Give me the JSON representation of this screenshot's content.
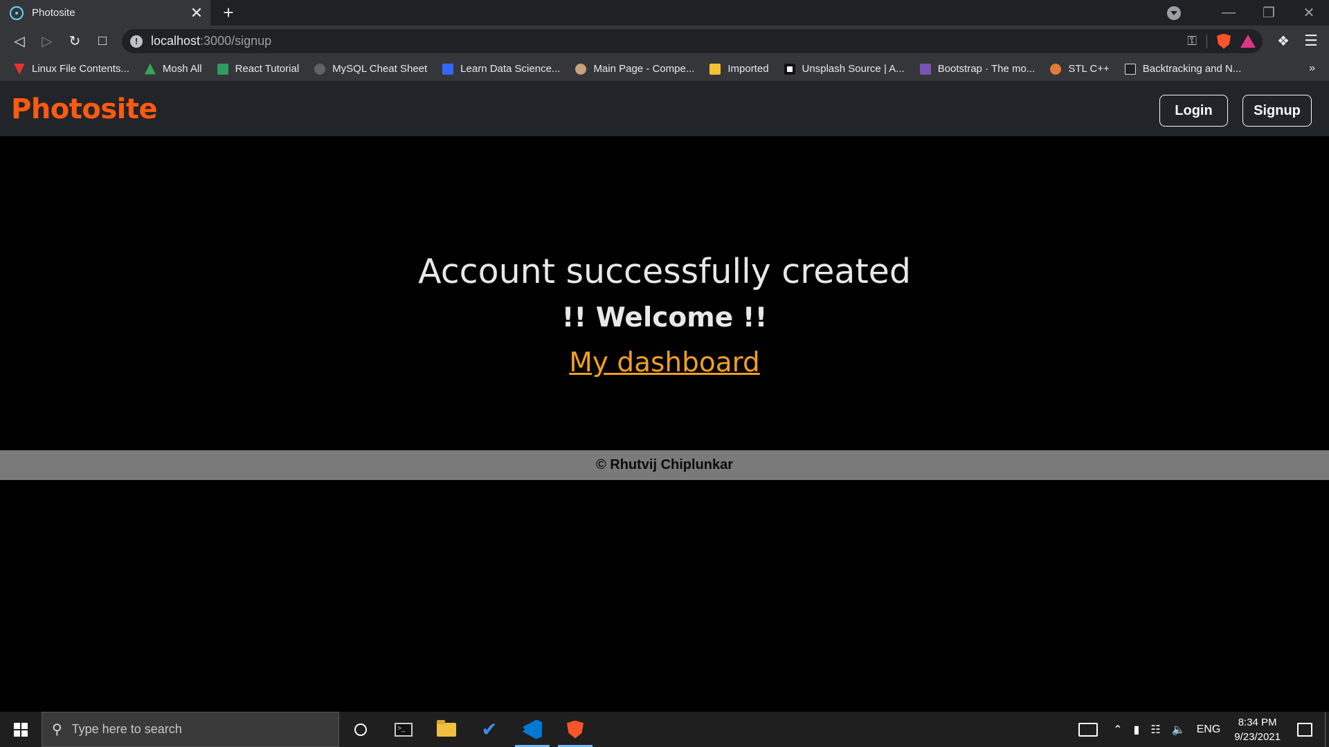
{
  "browser": {
    "tab_title": "Photosite",
    "tab_close": "✕",
    "new_tab": "+",
    "url_host": "localhost",
    "url_path": ":3000/signup",
    "bookmarks": [
      {
        "label": "Linux File Contents...",
        "color": "#e8332a"
      },
      {
        "label": "Mosh All",
        "color": "#34a853"
      },
      {
        "label": "React Tutorial",
        "color": "#2e9c5f"
      },
      {
        "label": "MySQL Cheat Sheet",
        "color": "#5f6368"
      },
      {
        "label": "Learn Data Science...",
        "color": "#3366ff"
      },
      {
        "label": "Main Page - Compe...",
        "color": "#c8a27c"
      },
      {
        "label": "Imported",
        "color": "#f2c230"
      },
      {
        "label": "Unsplash Source | A...",
        "color": "#111111"
      },
      {
        "label": "Bootstrap · The mo...",
        "color": "#7952b3"
      },
      {
        "label": "STL C++",
        "color": "#e07b39"
      },
      {
        "label": "Backtracking and N...",
        "color": "#222222"
      }
    ],
    "bookmarks_more": "»"
  },
  "site": {
    "brand": "Photosite",
    "login_label": "Login",
    "signup_label": "Signup",
    "headline": "Account successfully created",
    "welcome": "!! Welcome !!",
    "dashboard_link": "My dashboard",
    "footer": "© Rhutvij Chiplunkar",
    "brand_color": "#fd5a12",
    "link_color": "#f0a020"
  },
  "taskbar": {
    "search_placeholder": "Type here to search",
    "language": "ENG",
    "time": "8:34 PM",
    "date": "9/23/2021"
  }
}
